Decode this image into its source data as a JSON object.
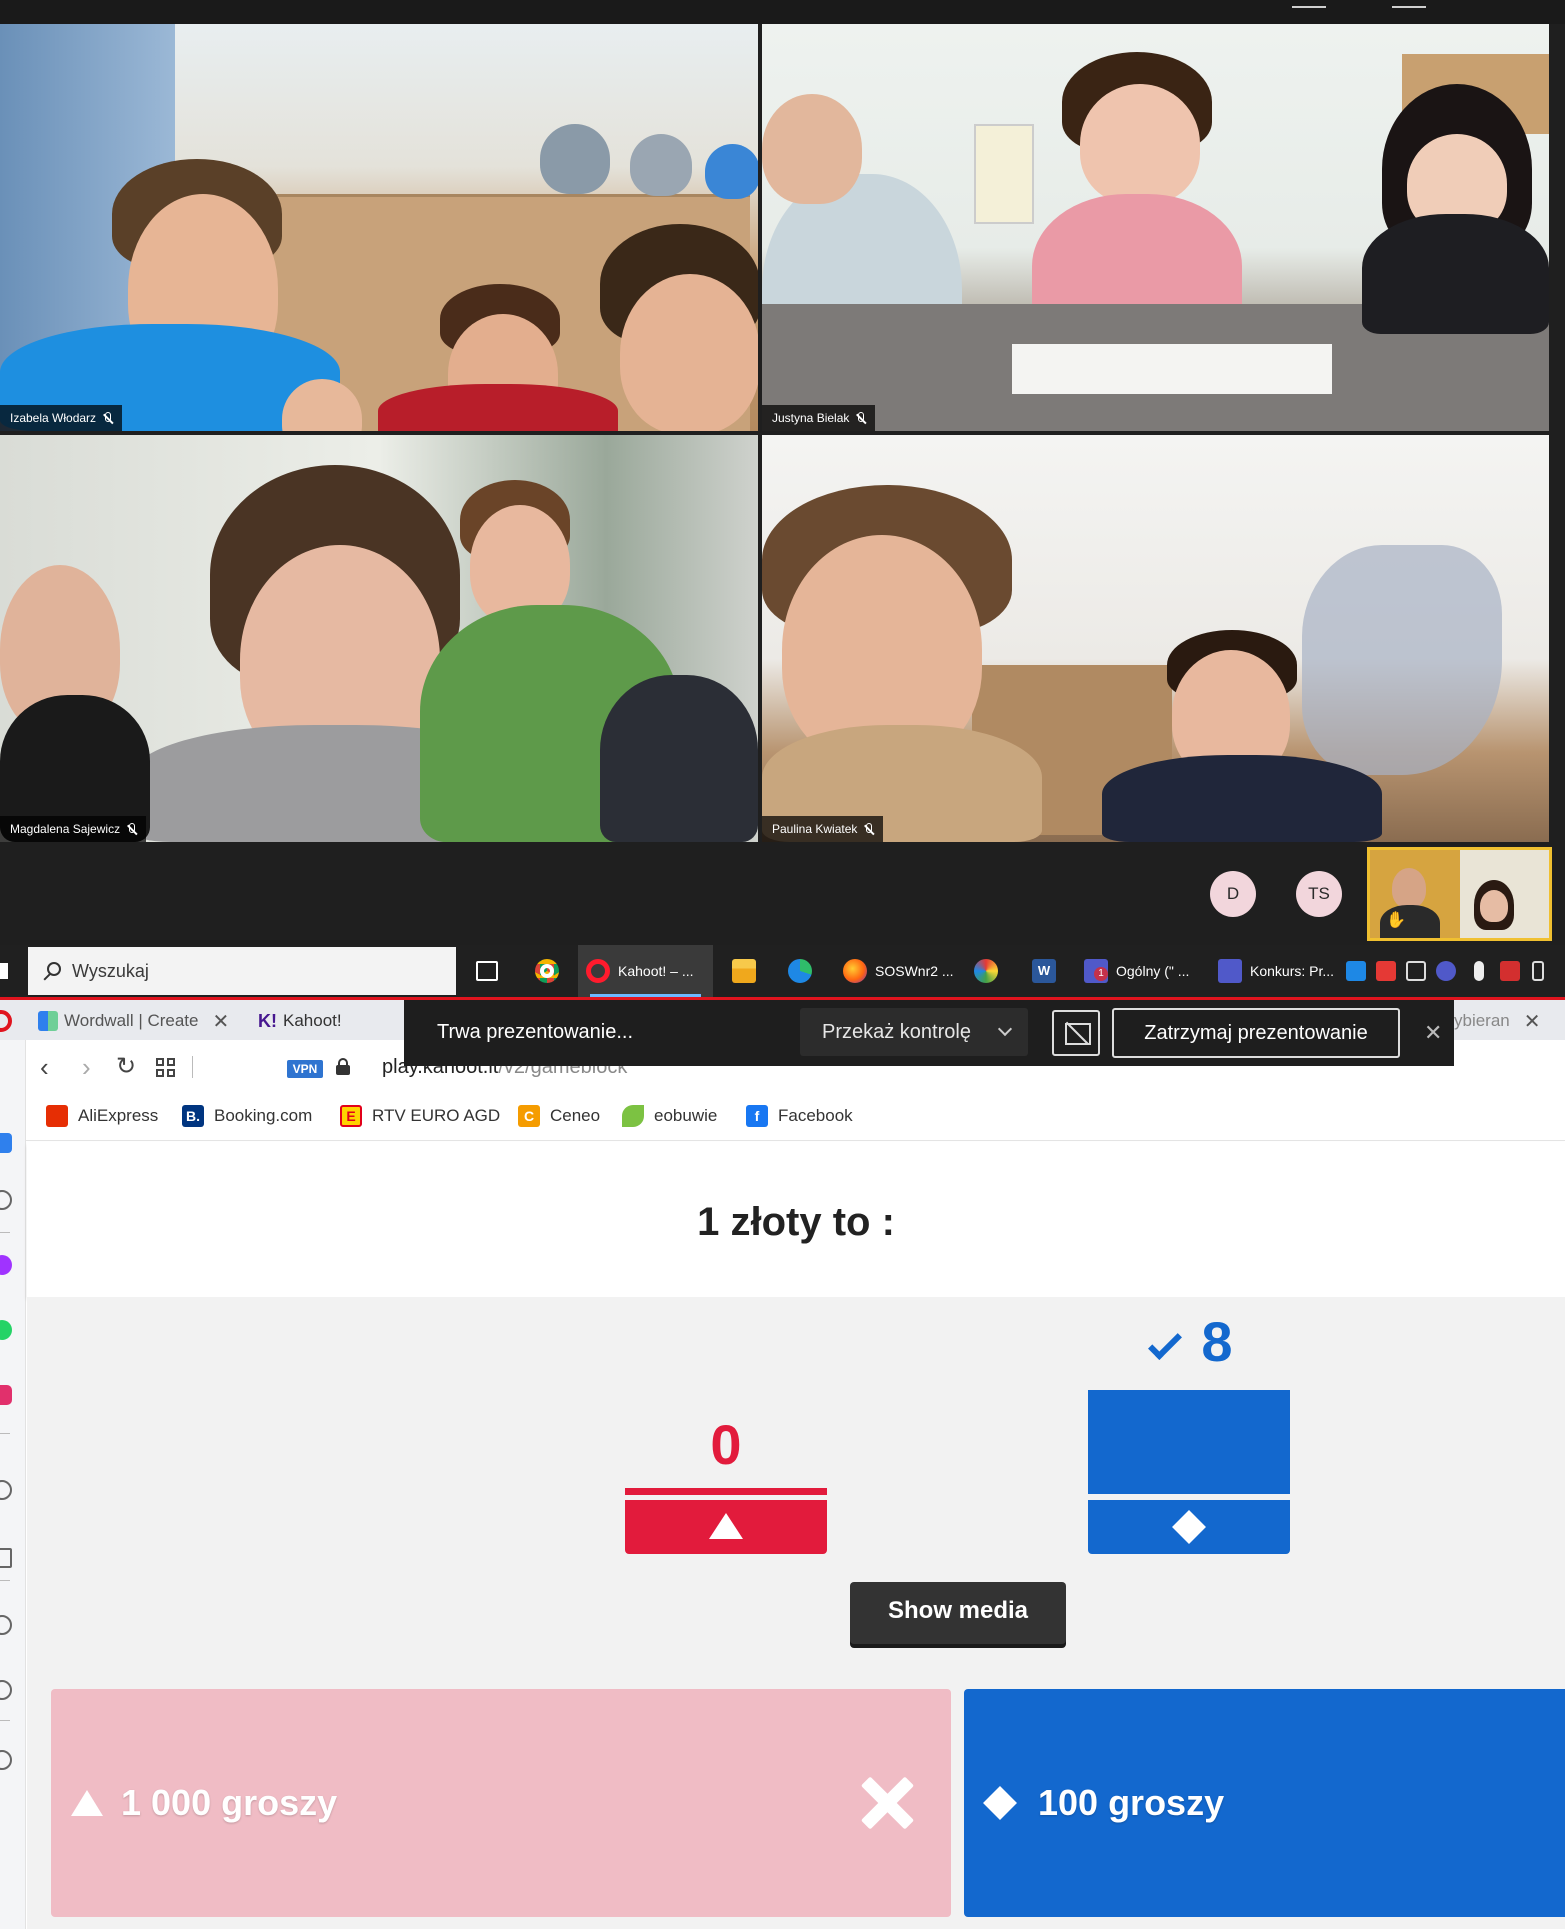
{
  "meeting": {
    "participants": [
      {
        "name": "Izabela Włodarz"
      },
      {
        "name": "Justyna Bielak"
      },
      {
        "name": "Magdalena Sajewicz"
      },
      {
        "name": "Paulina Kwiatek"
      }
    ],
    "avatars": [
      "D",
      "TS"
    ]
  },
  "taskbar": {
    "search_placeholder": "Wyszukaj",
    "items": [
      {
        "label": "Kahoot! – ..."
      },
      {
        "label": "SOSWnr2 ..."
      },
      {
        "label": "Ogólny (\" ..."
      },
      {
        "label": "Konkurs: Pr..."
      }
    ],
    "teams_badge": "1",
    "word_label": "W"
  },
  "browser": {
    "tabs": [
      {
        "label": "Wordwall | Create"
      },
      {
        "label": "Kahoot!"
      }
    ],
    "tab_right_label": "ybieran",
    "vpn_label": "VPN",
    "url_host": "play.kahoot.it",
    "url_path": "/v2/gameblock",
    "bookmarks": [
      {
        "label": "AliExpress"
      },
      {
        "label": "Booking.com"
      },
      {
        "label": "RTV EURO AGD"
      },
      {
        "label": "Ceneo"
      },
      {
        "label": "eobuwie"
      },
      {
        "label": "Facebook"
      }
    ],
    "bookmark_letters": {
      "booking": "B.",
      "rtv": "E",
      "ceneo": "C",
      "facebook": "f"
    },
    "kahoot_logo": "K!"
  },
  "presenting": {
    "status": "Trwa prezentowanie...",
    "handover": "Przekaż kontrolę",
    "stop": "Zatrzymaj prezentowanie"
  },
  "game": {
    "question": "1 złoty to :",
    "results": [
      {
        "shape": "triangle",
        "color": "#e21b3c",
        "count": "0",
        "correct": false
      },
      {
        "shape": "diamond",
        "color": "#1368ce",
        "count": "8",
        "correct": true
      }
    ],
    "show_media": "Show media",
    "answers": [
      {
        "label": "1 000 groszy",
        "shape": "triangle",
        "color": "#f0bcc5",
        "correct": false
      },
      {
        "label": "100 groszy",
        "shape": "diamond",
        "color": "#1368ce",
        "correct": true
      }
    ]
  }
}
